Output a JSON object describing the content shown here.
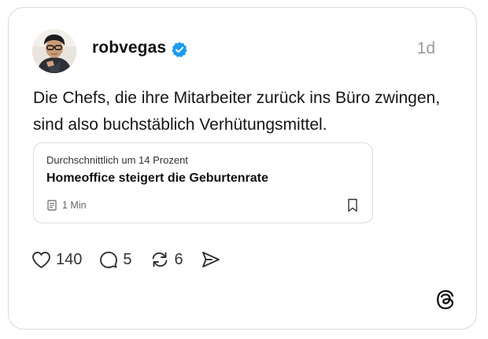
{
  "post": {
    "username": "robvegas",
    "time": "1d",
    "text": "Die Chefs, die ihre Mitarbeiter zurück ins Büro zwingen, sind also buchstäblich Verhütungsmittel."
  },
  "link_card": {
    "subtitle": "Durchschnittlich um 14 Prozent",
    "title": "Homeoffice steigert die Geburtenrate",
    "read_time": "1 Min"
  },
  "actions": {
    "likes": "140",
    "replies": "5",
    "reposts": "6"
  },
  "icons": {
    "like": "heart-icon",
    "reply": "comment-icon",
    "repost": "repost-icon",
    "share": "send-icon",
    "verified": "verified-badge-icon",
    "bookmark": "bookmark-icon",
    "article": "article-icon",
    "brand": "threads-logo-icon"
  },
  "colors": {
    "verified": "#1d9bf0",
    "text": "#161616",
    "muted": "#9a9a9a",
    "border": "#d9d9d9"
  }
}
